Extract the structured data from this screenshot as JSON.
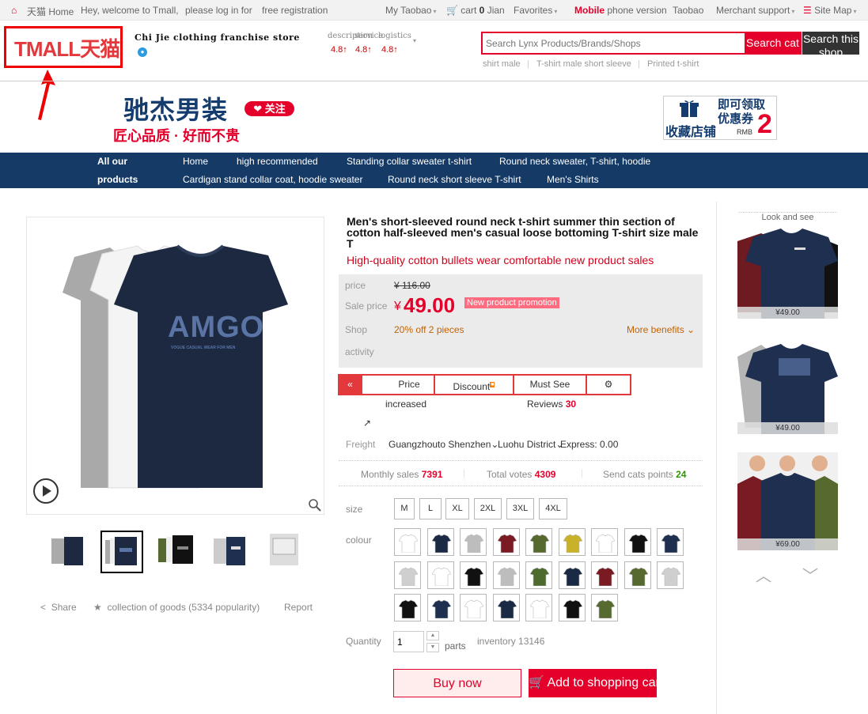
{
  "topbar": {
    "home_icon": "tmall-home-icon",
    "home": "天猫 Home",
    "welcome": "Hey, welcome to Tmall,",
    "login": "please log in for",
    "register": "free registration",
    "my_taobao": "My Taobao",
    "cart_prefix": "cart",
    "cart_count": "0",
    "cart_suffix": "Jian",
    "favorites": "Favorites",
    "mobile_bold": "Mobile",
    "mobile_rest": "phone version",
    "taobao": "Taobao",
    "merchant": "Merchant support",
    "sitemap": "Site Map"
  },
  "header": {
    "logo": "TMALL天猫",
    "store_name": "Chi Jie clothing franchise store",
    "ratings_headers": [
      "description",
      "service",
      "logistics"
    ],
    "ratings": [
      "4.8↑",
      "4.8↑",
      "4.8↑"
    ],
    "search_placeholder": "Search Lynx Products/Brands/Shops",
    "search_tmall": "Search cat",
    "search_shop": "Search this shop",
    "hot_words": [
      "shirt male",
      "T-shirt male short sleeve",
      "Printed t-shirt"
    ]
  },
  "banner": {
    "title": "驰杰男装",
    "follow": "❤ 关注",
    "slogan": "匠心品质 · 好而不贵",
    "coupon_shop": "收藏店铺",
    "coupon_title": "即可领取 优惠券",
    "coupon_unit": "RMB",
    "coupon_amount": "2"
  },
  "nav": {
    "all_products_1": "All our",
    "all_products_2": "products",
    "row1": [
      "Home",
      "high recommended",
      "Standing collar sweater t-shirt",
      "Round neck sweater, T-shirt, hoodie"
    ],
    "row2": [
      "Cardigan stand collar coat, hoodie sweater",
      "Round neck short sleeve T-shirt",
      "Men's Shirts"
    ]
  },
  "gallery": {
    "main_print": "AMGO",
    "main_print_sub": "VOGUE CASUAL WEAR FOR MEN",
    "share": "Share",
    "collection": "collection of goods (5334 popularity)",
    "report": "Report"
  },
  "product": {
    "title": "Men's short-sleeved round neck t-shirt summer thin section of cotton half-sleeved men's casual loose bottoming T-shirt size male T",
    "subtitle": "High-quality cotton bullets wear comfortable new product sales",
    "price_label": "price",
    "price_original": "¥ 116.00",
    "sale_label": "Sale price",
    "sale_currency": "¥",
    "sale_price": "49.00",
    "promo_tag": "New product promotion",
    "shop_label": "Shop",
    "activity_label": "activity",
    "shop_activity": "20% off 2 pieces",
    "more_benefits": "More benefits",
    "toolbar": {
      "price": "Price",
      "price_sub": "increased",
      "discount": "Discount",
      "must_see": "Must See",
      "reviews_label": "Reviews",
      "reviews_count": "30"
    },
    "freight_label": "Freight",
    "freight_from": "Guangzhou",
    "freight_to": "to Shenzhen",
    "freight_district": "Luohu District",
    "freight_express": "Express: 0.00",
    "monthly_sales_label": "Monthly sales",
    "monthly_sales": "7391",
    "total_votes_label": "Total votes",
    "total_votes": "4309",
    "send_points_label": "Send cats points",
    "send_points": "24",
    "size_label": "size",
    "sizes": [
      "M",
      "L",
      "XL",
      "2XL",
      "3XL",
      "4XL"
    ],
    "colour_label": "colour",
    "quantity_label": "Quantity",
    "quantity": "1",
    "quantity_unit": "parts",
    "inventory": "inventory 13146",
    "buy_now": "Buy now",
    "add_cart": "Add to shopping cart"
  },
  "rail": {
    "title": "Look and see",
    "items": [
      {
        "price": "¥49.00"
      },
      {
        "price": "¥49.00"
      },
      {
        "price": "¥69.00"
      }
    ]
  },
  "colors": {
    "brand_red": "#e4002b",
    "nav_blue": "#153a66",
    "swatches": [
      "#ffffff",
      "#1b2a44",
      "#bdbdbd",
      "#7a1a22",
      "#56692f",
      "#c9b22a",
      "#ffffff",
      "#111111",
      "#1f2f4f",
      "#cfcfcf",
      "#ffffff",
      "#111111",
      "#bdbdbd",
      "#4d6a2f",
      "#1b2a44",
      "#7a1a22",
      "#56692f",
      "#cfcfcf",
      "#111111",
      "#1f2f4f",
      "#ffffff",
      "#1b2a44",
      "#ffffff",
      "#111111",
      "#56692f"
    ]
  }
}
